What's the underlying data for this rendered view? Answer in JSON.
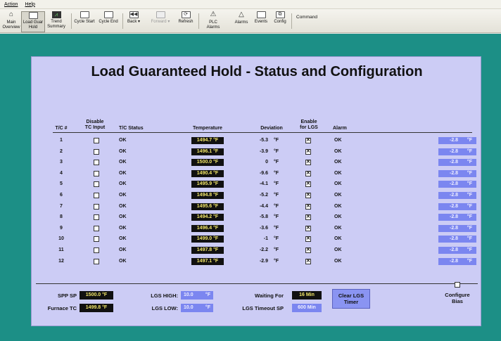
{
  "menu": [
    "Action",
    "Help"
  ],
  "toolbar": {
    "items": [
      {
        "label": "Main\nOverview",
        "icon": "home-icon"
      },
      {
        "label": "Load Guar\nHold",
        "icon": "window-icon",
        "active": true
      },
      {
        "label": "Trend\nSummary",
        "icon": "trend-icon"
      },
      {
        "label": "Cycle Start",
        "icon": "window-icon"
      },
      {
        "label": "Cycle End",
        "icon": "window-icon"
      },
      {
        "label": "Back",
        "icon": "back-icon"
      },
      {
        "label": "Forward",
        "icon": "forward-icon",
        "disabled": true
      },
      {
        "label": "Refresh",
        "icon": "refresh-icon"
      },
      {
        "label": "PLC\nAlarms",
        "icon": "plc-alarm-icon"
      },
      {
        "label": "Alarms",
        "icon": "alarm-triangle-icon"
      },
      {
        "label": "Events",
        "icon": "window-icon"
      },
      {
        "label": "Config",
        "icon": "config-icon"
      },
      {
        "label": "Command",
        "icon": ""
      }
    ]
  },
  "panel": {
    "title": "Load Guaranteed Hold - Status and Configuration",
    "headers": {
      "tc": "T/C #",
      "disable": "Disable\nTC Input",
      "status": "T/C Status",
      "temperature": "Temperature",
      "deviation": "Deviation",
      "enable": "Enable\nfor LGS",
      "alarm": "Alarm"
    },
    "rows": [
      {
        "tc": "1",
        "status": "OK",
        "temp": "1494.7 °F",
        "dev": "-5.3",
        "unit": "°F",
        "alarm": "OK",
        "bias": "-2.8",
        "bias_unit": "°F"
      },
      {
        "tc": "2",
        "status": "OK",
        "temp": "1496.1 °F",
        "dev": "-3.9",
        "unit": "°F",
        "alarm": "OK",
        "bias": "-2.8",
        "bias_unit": "°F"
      },
      {
        "tc": "3",
        "status": "OK",
        "temp": "1500.0 °F",
        "dev": "0",
        "unit": "°F",
        "alarm": "OK",
        "bias": "-2.8",
        "bias_unit": "°F"
      },
      {
        "tc": "4",
        "status": "OK",
        "temp": "1490.4 °F",
        "dev": "-9.6",
        "unit": "°F",
        "alarm": "OK",
        "bias": "-2.8",
        "bias_unit": "°F"
      },
      {
        "tc": "5",
        "status": "OK",
        "temp": "1495.9 °F",
        "dev": "-4.1",
        "unit": "°F",
        "alarm": "OK",
        "bias": "-2.8",
        "bias_unit": "°F"
      },
      {
        "tc": "6",
        "status": "OK",
        "temp": "1494.8 °F",
        "dev": "-5.2",
        "unit": "°F",
        "alarm": "OK",
        "bias": "-2.8",
        "bias_unit": "°F"
      },
      {
        "tc": "7",
        "status": "OK",
        "temp": "1495.6 °F",
        "dev": "-4.4",
        "unit": "°F",
        "alarm": "OK",
        "bias": "-2.8",
        "bias_unit": "°F"
      },
      {
        "tc": "8",
        "status": "OK",
        "temp": "1494.2 °F",
        "dev": "-5.8",
        "unit": "°F",
        "alarm": "OK",
        "bias": "-2.8",
        "bias_unit": "°F"
      },
      {
        "tc": "9",
        "status": "OK",
        "temp": "1496.4 °F",
        "dev": "-3.6",
        "unit": "°F",
        "alarm": "OK",
        "bias": "-2.8",
        "bias_unit": "°F"
      },
      {
        "tc": "10",
        "status": "OK",
        "temp": "1499.0 °F",
        "dev": "-1",
        "unit": "°F",
        "alarm": "OK",
        "bias": "-2.8",
        "bias_unit": "°F"
      },
      {
        "tc": "11",
        "status": "OK",
        "temp": "1497.8 °F",
        "dev": "-2.2",
        "unit": "°F",
        "alarm": "OK",
        "bias": "-2.8",
        "bias_unit": "°F"
      },
      {
        "tc": "12",
        "status": "OK",
        "temp": "1497.1 °F",
        "dev": "-2.9",
        "unit": "°F",
        "alarm": "OK",
        "bias": "-2.8",
        "bias_unit": "°F"
      }
    ],
    "bottom": {
      "spp_sp_label": "SPP SP",
      "spp_sp_value": "1500.0 °F",
      "furnace_tc_label": "Furnace TC",
      "furnace_tc_value": "1499.8 °F",
      "lgs_high_label": "LGS HIGH:",
      "lgs_high_value": "10.0",
      "lgs_high_unit": "°F",
      "lgs_low_label": "LGS LOW:",
      "lgs_low_value": "10.0",
      "lgs_low_unit": "°F",
      "waiting_for_label": "Waiting For",
      "waiting_for_value": "16 Min",
      "lgs_timeout_label": "LGS Timeout SP",
      "lgs_timeout_value": "600 Min",
      "clear_button": "Clear LGS\nTimer",
      "configure_bias": "Configure\nBias"
    }
  },
  "colors": {
    "background": "#1c8f86",
    "panel": "#ccccf5",
    "value_box": "#111111",
    "value_text": "#f2e66a",
    "bias_box": "#7b86f0"
  }
}
